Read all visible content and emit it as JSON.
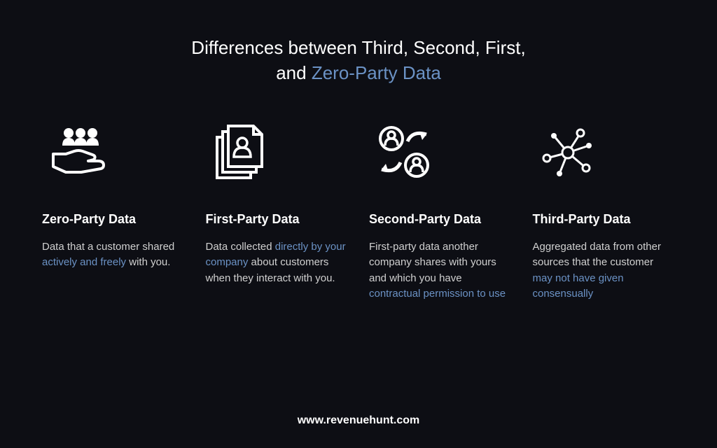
{
  "header": {
    "title_line1": "Differences between Third, Second, First,",
    "title_line2_prefix": "and ",
    "title_line2_accent": "Zero-Party Data"
  },
  "columns": [
    {
      "title": "Zero-Party Data",
      "desc_prefix": "Data that a customer shared ",
      "desc_highlight": "actively and freely",
      "desc_suffix": " with you."
    },
    {
      "title": "First-Party Data",
      "desc_prefix": "Data collected ",
      "desc_highlight": "directly by your company",
      "desc_suffix": " about customers when they interact with you."
    },
    {
      "title": "Second-Party Data",
      "desc_prefix": "First-party data another company shares with yours and which you have ",
      "desc_highlight": "contractual permission to use",
      "desc_suffix": ""
    },
    {
      "title": "Third-Party Data",
      "desc_prefix": "Aggregated data from other sources that the customer ",
      "desc_highlight": "may not have given consensually",
      "desc_suffix": ""
    }
  ],
  "footer": {
    "url": "www.revenuehunt.com"
  }
}
